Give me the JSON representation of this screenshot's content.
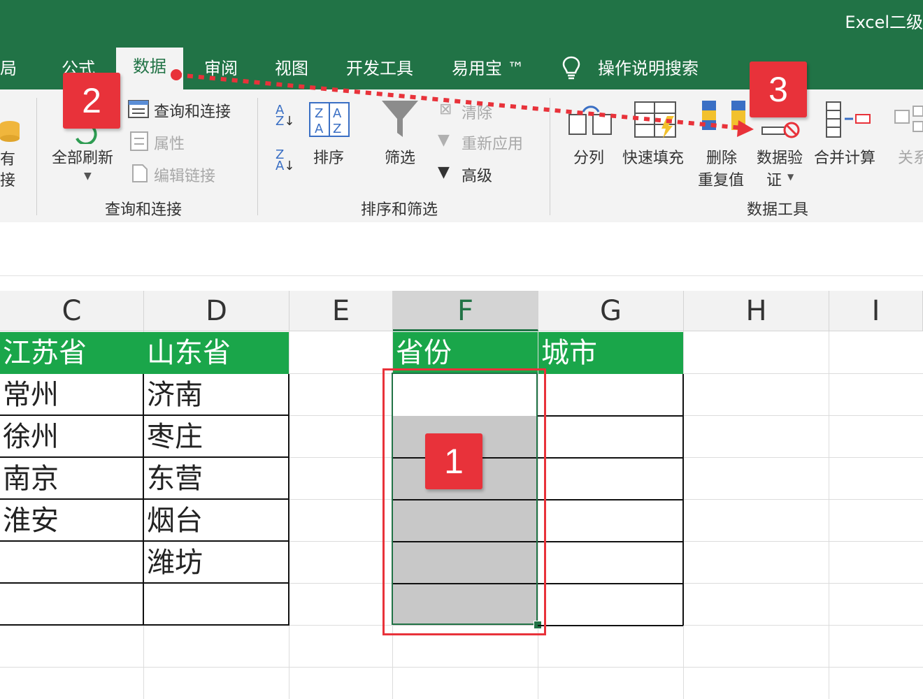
{
  "app_title": "Excel二级",
  "tabs": [
    "布局",
    "公式",
    "数据",
    "审阅",
    "视图",
    "开发工具",
    "易用宝 ™",
    "操作说明搜索"
  ],
  "tab_visible": {
    "layout": "局",
    "formula": "公式",
    "data": "数据",
    "review": "审阅",
    "view": "视图",
    "dev": "开发工具",
    "easy": "易用宝 ™",
    "search": "操作说明搜索"
  },
  "ribbon": {
    "get_data_partial": {
      "line1": "有",
      "line2": "接"
    },
    "refresh_all": "全部刷新",
    "queries_connections": "查询和连接",
    "properties": "属性",
    "edit_links": "编辑链接",
    "group_queries": "查询和连接",
    "sort": "排序",
    "filter": "筛选",
    "clear": "清除",
    "reapply": "重新应用",
    "advanced": "高级",
    "group_sort_filter": "排序和筛选",
    "text_to_columns": "分列",
    "flash_fill": "快速填充",
    "remove_dup_line1": "删除",
    "remove_dup_line2": "重复值",
    "data_validation_line1": "数据验",
    "data_validation_line2": "证",
    "consolidate": "合并计算",
    "relationships_partial": "关系",
    "group_data_tools": "数据工具"
  },
  "columns": [
    "C",
    "D",
    "E",
    "F",
    "G",
    "H",
    "I"
  ],
  "sheet": {
    "headers": {
      "C": "江苏省",
      "D": "山东省",
      "F": "省份",
      "G": "城市"
    },
    "col_c": [
      "常州",
      "徐州",
      "南京",
      "淮安",
      "",
      ""
    ],
    "col_d": [
      "济南",
      "枣庄",
      "东营",
      "烟台",
      "潍坊",
      ""
    ]
  },
  "annotations": {
    "step1": "1",
    "step2": "2",
    "step3": "3"
  },
  "colors": {
    "excel_green": "#217346",
    "header_green": "#1aa64a",
    "annotation_red": "#e8323a",
    "selection_gray": "#c8c8c8"
  }
}
